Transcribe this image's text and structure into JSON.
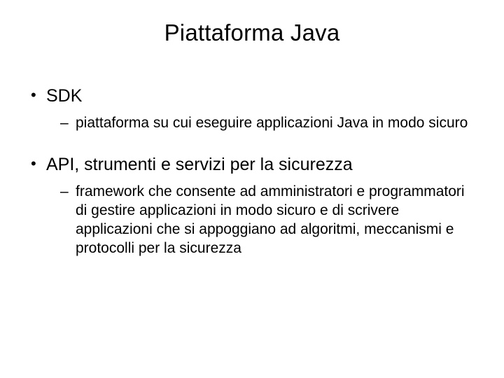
{
  "title": "Piattaforma Java",
  "items": [
    {
      "label": "SDK",
      "sub": [
        "piattaforma su cui eseguire applicazioni Java in modo sicuro"
      ]
    },
    {
      "label": "API, strumenti e servizi per la sicurezza",
      "sub": [
        "framework che consente ad amministratori e programmatori di gestire applicazioni in modo sicuro e di scrivere applicazioni che si appoggiano ad algoritmi, meccanismi e protocolli per la sicurezza"
      ]
    }
  ]
}
